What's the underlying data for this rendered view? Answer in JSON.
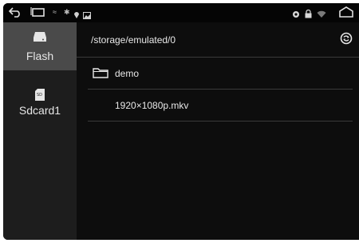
{
  "status": {
    "usb_label": "≈",
    "bt_label": "✱"
  },
  "drawer": {
    "items": [
      {
        "label": "Flash",
        "icon": "flash-drive-icon",
        "active": true
      },
      {
        "label": "Sdcard1",
        "icon": "sd-card-icon",
        "sd_text": "SD",
        "active": false
      }
    ]
  },
  "main": {
    "path": "/storage/emulated/0",
    "entries": [
      {
        "type": "folder",
        "name": "demo",
        "icon": "folder-icon"
      },
      {
        "type": "file",
        "name": "1920×1080p.mkv"
      }
    ]
  }
}
